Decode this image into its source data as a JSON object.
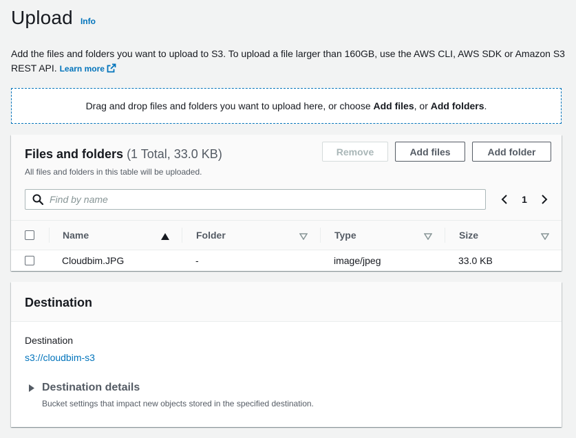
{
  "page": {
    "title": "Upload",
    "info_link": "Info"
  },
  "description": {
    "text": "Add the files and folders you want to upload to S3. To upload a file larger than 160GB, use the AWS CLI, AWS SDK or Amazon S3 REST API.",
    "learn_more": "Learn more"
  },
  "dropzone": {
    "text_before": "Drag and drop files and folders you want to upload here, or choose ",
    "add_files": "Add files",
    "text_middle": ", or ",
    "add_folders": "Add folders",
    "text_after": "."
  },
  "files_panel": {
    "title": "Files and folders",
    "count": "(1 Total, 33.0 KB)",
    "subtitle": "All files and folders in this table will be uploaded.",
    "buttons": {
      "remove": "Remove",
      "add_files": "Add files",
      "add_folder": "Add folder"
    },
    "search": {
      "placeholder": "Find by name",
      "value": ""
    },
    "pagination": {
      "current_page": "1"
    },
    "columns": [
      "Name",
      "Folder",
      "Type",
      "Size"
    ],
    "rows": [
      {
        "name": "Cloudbim.JPG",
        "folder": "-",
        "type": "image/jpeg",
        "size": "33.0 KB"
      }
    ]
  },
  "destination_panel": {
    "title": "Destination",
    "label": "Destination",
    "value": "s3://cloudbim-s3",
    "details_title": "Destination details",
    "details_subtitle": "Bucket settings that impact new objects stored in the specified destination."
  },
  "colors": {
    "link": "#0073bb",
    "text": "#16191f",
    "muted": "#545b64",
    "background": "#f2f3f3"
  },
  "icons": [
    "external-link-icon",
    "search-icon",
    "chevron-left-icon",
    "chevron-right-icon",
    "sort-ascending-icon",
    "sort-icon",
    "caret-right-icon"
  ]
}
